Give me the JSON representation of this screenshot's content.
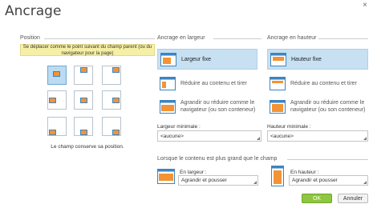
{
  "dialog": {
    "title": "Ancrage",
    "close_glyph": "×"
  },
  "position": {
    "title": "Position",
    "tooltip": "Se déplacer comme le point suivant du champ parent (ou du navigateur pour la page)",
    "note": "Le champ conserve sa position.",
    "selected_cell": "top-left",
    "cells": [
      "top-left",
      "top-center",
      "top-right",
      "middle-left",
      "center",
      "middle-right",
      "bottom-left",
      "bottom-center",
      "bottom-right"
    ]
  },
  "width": {
    "title": "Ancrage en largeur",
    "options": [
      {
        "label_line1": "Largeur fixe",
        "label_line2": "",
        "icon": "fixed-width-icon",
        "selected": true
      },
      {
        "label_line1": "Réduire au contenu et tirer",
        "label_line2": "",
        "icon": "shrink-width-icon",
        "selected": false
      },
      {
        "label_line1": "Agrandir ou réduire comme le",
        "label_line2": "navigateur (ou son conteneur)",
        "icon": "grow-width-icon",
        "selected": false
      }
    ],
    "min_label": "Largeur minimale :",
    "min_value": "<aucune>"
  },
  "height": {
    "title": "Ancrage en hauteur",
    "options": [
      {
        "label_line1": "Hauteur fixe",
        "label_line2": "",
        "icon": "fixed-height-icon",
        "selected": true
      },
      {
        "label_line1": "Réduire au contenu et tirer",
        "label_line2": "",
        "icon": "shrink-height-icon",
        "selected": false
      },
      {
        "label_line1": "Agrandir ou réduire comme le",
        "label_line2": "navigateur (ou son conteneur)",
        "icon": "grow-height-icon",
        "selected": false
      }
    ],
    "min_label": "Hauteur minimale :",
    "min_value": "<aucune>"
  },
  "overflow": {
    "title": "Lorsque le contenu est plus grand que le champ",
    "width_label": "En largeur :",
    "width_value": "Agrandir et pousser",
    "height_label": "En hauteur :",
    "height_value": "Agrandir et pousser"
  },
  "buttons": {
    "ok": "OK",
    "cancel": "Annuler"
  },
  "colors": {
    "accent_orange": "#f29335",
    "accent_blue": "#3b84c4",
    "selection_blue": "#c7e0f2",
    "ok_green": "#8ec63f"
  }
}
